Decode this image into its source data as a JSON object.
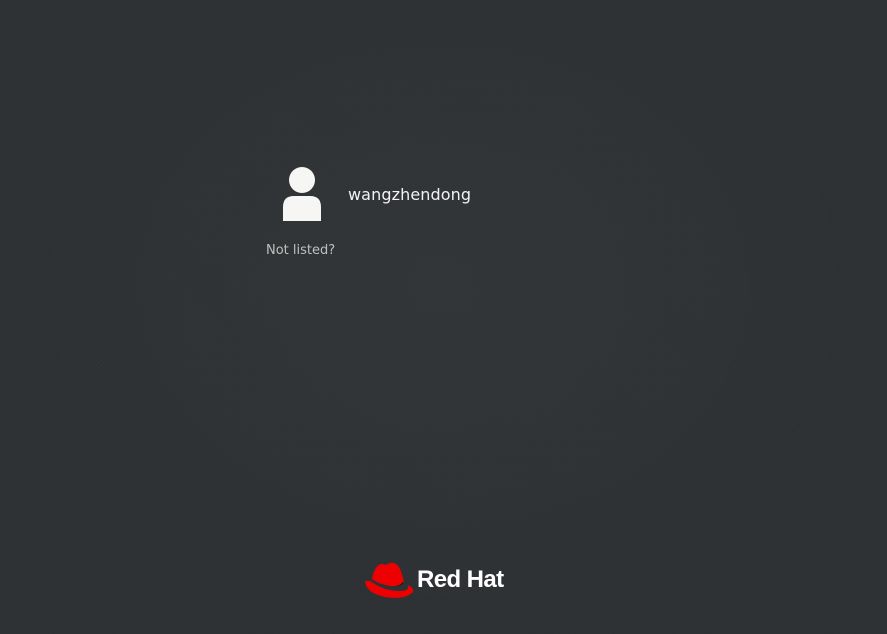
{
  "users": [
    {
      "name": "wangzhendong",
      "avatar_icon": "user-avatar-icon"
    }
  ],
  "not_listed_label": "Not listed?",
  "brand": {
    "logo_icon": "red-hat-fedora-icon",
    "name": "Red Hat",
    "accent_color": "#ee0000"
  },
  "colors": {
    "background": "#2e3134",
    "text": "#f2f2f2",
    "muted_text": "#bfc0bd"
  }
}
